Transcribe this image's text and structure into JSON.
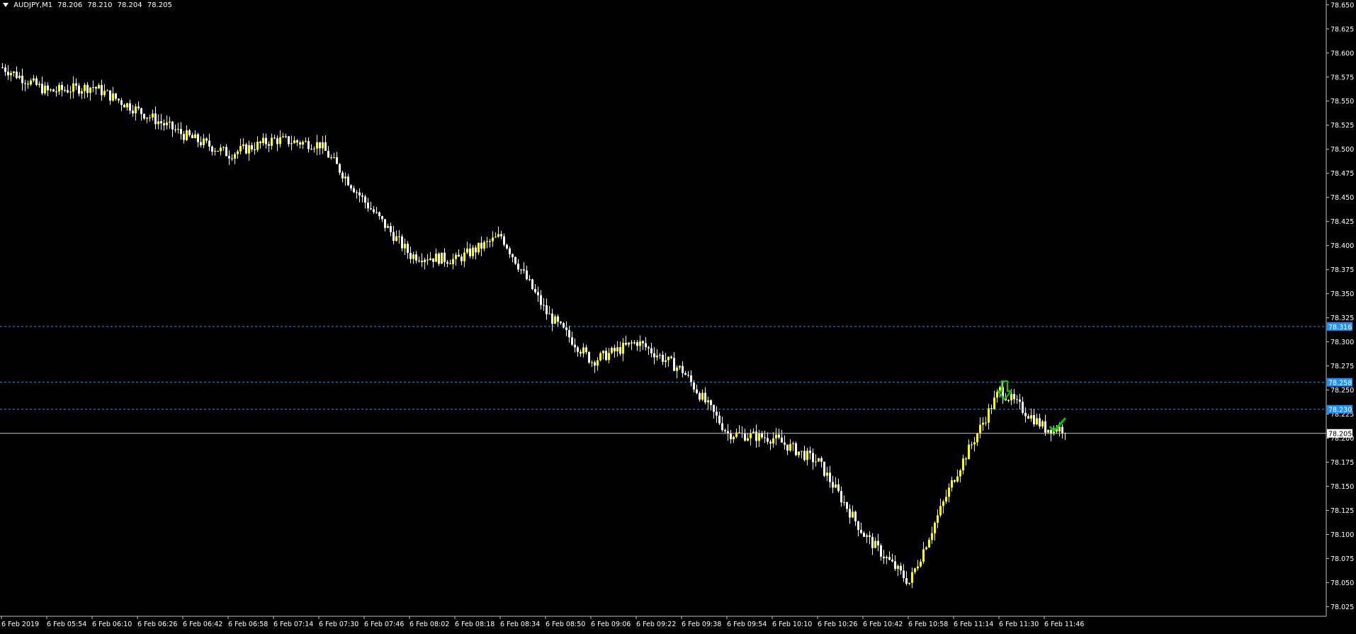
{
  "header": {
    "symbol": "AUDJPY,M1",
    "open": "78.206",
    "high": "78.210",
    "low": "78.204",
    "close": "78.205"
  },
  "colors": {
    "background": "#000000",
    "axis": "#c0c0c0",
    "text": "#ffffff",
    "bull_candle": "#ffff00",
    "bear_candle": "#ffffff",
    "level_line": "#1e90ff",
    "price_line": "#c0c0c0",
    "marker": "#00cc00"
  },
  "chart_data": {
    "type": "candlestick",
    "title": "AUDJPY,M1",
    "xlabel": "",
    "ylabel": "",
    "ylim": [
      78.015,
      78.655
    ],
    "grid": false,
    "y_ticks": [
      "78.650",
      "78.625",
      "78.600",
      "78.575",
      "78.550",
      "78.525",
      "78.500",
      "78.475",
      "78.450",
      "78.425",
      "78.400",
      "78.375",
      "78.350",
      "78.325",
      "78.300",
      "78.275",
      "78.250",
      "78.225",
      "78.200",
      "78.175",
      "78.150",
      "78.125",
      "78.100",
      "78.075",
      "78.050",
      "78.025"
    ],
    "x_ticks": [
      "6 Feb 2019",
      "6 Feb 05:54",
      "6 Feb 06:10",
      "6 Feb 06:26",
      "6 Feb 06:42",
      "6 Feb 06:58",
      "6 Feb 07:14",
      "6 Feb 07:30",
      "6 Feb 07:46",
      "6 Feb 08:02",
      "6 Feb 08:18",
      "6 Feb 08:34",
      "6 Feb 08:50",
      "6 Feb 09:06",
      "6 Feb 09:22",
      "6 Feb 09:38",
      "6 Feb 09:54",
      "6 Feb 10:10",
      "6 Feb 10:26",
      "6 Feb 10:42",
      "6 Feb 10:58",
      "6 Feb 11:14",
      "6 Feb 11:30",
      "6 Feb 11:46"
    ],
    "price_path": [
      [
        "6 Feb 2019",
        78.585
      ],
      [
        "6 Feb 05:54",
        78.56
      ],
      [
        "6 Feb 06:10",
        78.565
      ],
      [
        "6 Feb 06:26",
        78.54
      ],
      [
        "6 Feb 06:42",
        78.515
      ],
      [
        "6 Feb 06:58",
        78.495
      ],
      [
        "6 Feb 07:14",
        78.51
      ],
      [
        "6 Feb 07:30",
        78.505
      ],
      [
        "6 Feb 07:46",
        78.445
      ],
      [
        "6 Feb 08:02",
        78.39
      ],
      [
        "6 Feb 08:18",
        78.385
      ],
      [
        "6 Feb 08:34",
        78.41
      ],
      [
        "6 Feb 08:50",
        78.33
      ],
      [
        "6 Feb 09:06",
        78.28
      ],
      [
        "6 Feb 09:22",
        78.3
      ],
      [
        "6 Feb 09:38",
        78.27
      ],
      [
        "6 Feb 09:54",
        78.205
      ],
      [
        "6 Feb 10:10",
        78.2
      ],
      [
        "6 Feb 10:26",
        78.175
      ],
      [
        "6 Feb 10:42",
        78.1
      ],
      [
        "6 Feb 10:58",
        78.05
      ],
      [
        "6 Feb 11:14",
        78.16
      ],
      [
        "6 Feb 11:30",
        78.25
      ],
      [
        "6 Feb 11:46",
        78.21
      ]
    ],
    "horizontal_levels": [
      {
        "label": "78.316",
        "value": 78.316,
        "style": "dashed"
      },
      {
        "label": "78.258",
        "value": 78.258,
        "style": "dashed"
      },
      {
        "label": "78.230",
        "value": 78.23,
        "style": "dashed"
      },
      {
        "label": "78.205",
        "value": 78.205,
        "style": "solid"
      }
    ],
    "markers": [
      {
        "type": "down-arrow",
        "time": "6 Feb 11:30",
        "value": 78.24
      },
      {
        "type": "check",
        "time": "6 Feb 11:46",
        "value": 78.212
      }
    ]
  }
}
